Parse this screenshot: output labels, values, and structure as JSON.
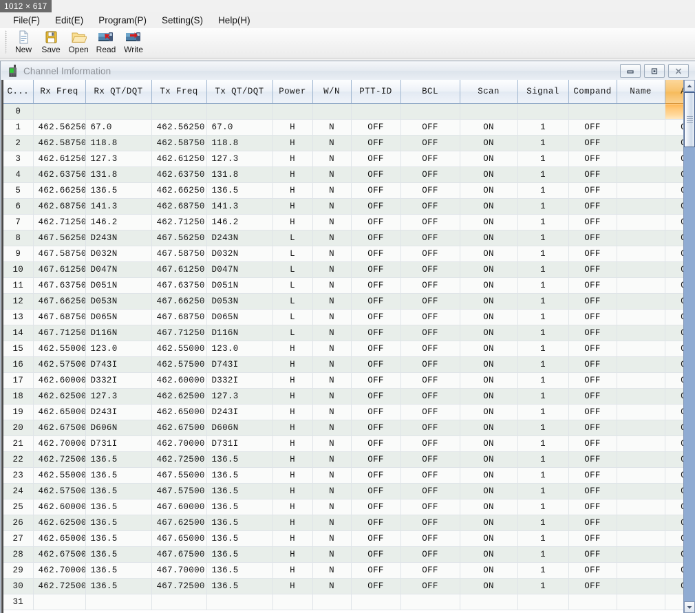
{
  "overlay": {
    "dimensions": "1012 × 617"
  },
  "menubar": {
    "items": [
      {
        "label": "File(F)",
        "name": "menu-file"
      },
      {
        "label": "Edit(E)",
        "name": "menu-edit"
      },
      {
        "label": "Program(P)",
        "name": "menu-program"
      },
      {
        "label": "Setting(S)",
        "name": "menu-setting"
      },
      {
        "label": "Help(H)",
        "name": "menu-help"
      }
    ]
  },
  "toolbar": {
    "buttons": [
      {
        "label": "New",
        "icon": "new-document-icon"
      },
      {
        "label": "Save",
        "icon": "floppy-disk-icon"
      },
      {
        "label": "Open",
        "icon": "folder-open-icon"
      },
      {
        "label": "Read",
        "icon": "read-from-radio-icon"
      },
      {
        "label": "Write",
        "icon": "write-to-radio-icon"
      }
    ]
  },
  "window": {
    "title": "Channel Imformation",
    "icon": "handheld-radio-icon",
    "minimize_label": "Minimize",
    "restore_label": "Restore",
    "close_label": "Close"
  },
  "grid": {
    "selected_column": "ANI",
    "columns": [
      "C...",
      "Rx Freq",
      "Rx QT/DQT",
      "Tx Freq",
      "Tx QT/DQT",
      "Power",
      "W/N",
      "PTT-ID",
      "BCL",
      "Scan",
      "Signal",
      "Compand",
      "Name",
      "ANI"
    ],
    "rows": [
      [
        "0",
        "",
        "",
        "",
        "",
        "",
        "",
        "",
        "",
        "",
        "",
        "",
        "",
        ""
      ],
      [
        "1",
        "462.56250",
        "67.0",
        "462.56250",
        "67.0",
        "H",
        "N",
        "OFF",
        "OFF",
        "ON",
        "1",
        "OFF",
        "",
        "OFF"
      ],
      [
        "2",
        "462.58750",
        "118.8",
        "462.58750",
        "118.8",
        "H",
        "N",
        "OFF",
        "OFF",
        "ON",
        "1",
        "OFF",
        "",
        "OFF"
      ],
      [
        "3",
        "462.61250",
        "127.3",
        "462.61250",
        "127.3",
        "H",
        "N",
        "OFF",
        "OFF",
        "ON",
        "1",
        "OFF",
        "",
        "OFF"
      ],
      [
        "4",
        "462.63750",
        "131.8",
        "462.63750",
        "131.8",
        "H",
        "N",
        "OFF",
        "OFF",
        "ON",
        "1",
        "OFF",
        "",
        "OFF"
      ],
      [
        "5",
        "462.66250",
        "136.5",
        "462.66250",
        "136.5",
        "H",
        "N",
        "OFF",
        "OFF",
        "ON",
        "1",
        "OFF",
        "",
        "OFF"
      ],
      [
        "6",
        "462.68750",
        "141.3",
        "462.68750",
        "141.3",
        "H",
        "N",
        "OFF",
        "OFF",
        "ON",
        "1",
        "OFF",
        "",
        "OFF"
      ],
      [
        "7",
        "462.71250",
        "146.2",
        "462.71250",
        "146.2",
        "H",
        "N",
        "OFF",
        "OFF",
        "ON",
        "1",
        "OFF",
        "",
        "OFF"
      ],
      [
        "8",
        "467.56250",
        "D243N",
        "467.56250",
        "D243N",
        "L",
        "N",
        "OFF",
        "OFF",
        "ON",
        "1",
        "OFF",
        "",
        "OFF"
      ],
      [
        "9",
        "467.58750",
        "D032N",
        "467.58750",
        "D032N",
        "L",
        "N",
        "OFF",
        "OFF",
        "ON",
        "1",
        "OFF",
        "",
        "OFF"
      ],
      [
        "10",
        "467.61250",
        "D047N",
        "467.61250",
        "D047N",
        "L",
        "N",
        "OFF",
        "OFF",
        "ON",
        "1",
        "OFF",
        "",
        "OFF"
      ],
      [
        "11",
        "467.63750",
        "D051N",
        "467.63750",
        "D051N",
        "L",
        "N",
        "OFF",
        "OFF",
        "ON",
        "1",
        "OFF",
        "",
        "OFF"
      ],
      [
        "12",
        "467.66250",
        "D053N",
        "467.66250",
        "D053N",
        "L",
        "N",
        "OFF",
        "OFF",
        "ON",
        "1",
        "OFF",
        "",
        "OFF"
      ],
      [
        "13",
        "467.68750",
        "D065N",
        "467.68750",
        "D065N",
        "L",
        "N",
        "OFF",
        "OFF",
        "ON",
        "1",
        "OFF",
        "",
        "OFF"
      ],
      [
        "14",
        "467.71250",
        "D116N",
        "467.71250",
        "D116N",
        "L",
        "N",
        "OFF",
        "OFF",
        "ON",
        "1",
        "OFF",
        "",
        "OFF"
      ],
      [
        "15",
        "462.55000",
        "123.0",
        "462.55000",
        "123.0",
        "H",
        "N",
        "OFF",
        "OFF",
        "ON",
        "1",
        "OFF",
        "",
        "OFF"
      ],
      [
        "16",
        "462.57500",
        "D743I",
        "462.57500",
        "D743I",
        "H",
        "N",
        "OFF",
        "OFF",
        "ON",
        "1",
        "OFF",
        "",
        "OFF"
      ],
      [
        "17",
        "462.60000",
        "D332I",
        "462.60000",
        "D332I",
        "H",
        "N",
        "OFF",
        "OFF",
        "ON",
        "1",
        "OFF",
        "",
        "OFF"
      ],
      [
        "18",
        "462.62500",
        "127.3",
        "462.62500",
        "127.3",
        "H",
        "N",
        "OFF",
        "OFF",
        "ON",
        "1",
        "OFF",
        "",
        "OFF"
      ],
      [
        "19",
        "462.65000",
        "D243I",
        "462.65000",
        "D243I",
        "H",
        "N",
        "OFF",
        "OFF",
        "ON",
        "1",
        "OFF",
        "",
        "OFF"
      ],
      [
        "20",
        "462.67500",
        "D606N",
        "462.67500",
        "D606N",
        "H",
        "N",
        "OFF",
        "OFF",
        "ON",
        "1",
        "OFF",
        "",
        "OFF"
      ],
      [
        "21",
        "462.70000",
        "D731I",
        "462.70000",
        "D731I",
        "H",
        "N",
        "OFF",
        "OFF",
        "ON",
        "1",
        "OFF",
        "",
        "OFF"
      ],
      [
        "22",
        "462.72500",
        "136.5",
        "462.72500",
        "136.5",
        "H",
        "N",
        "OFF",
        "OFF",
        "ON",
        "1",
        "OFF",
        "",
        "OFF"
      ],
      [
        "23",
        "462.55000",
        "136.5",
        "467.55000",
        "136.5",
        "H",
        "N",
        "OFF",
        "OFF",
        "ON",
        "1",
        "OFF",
        "",
        "OFF"
      ],
      [
        "24",
        "462.57500",
        "136.5",
        "467.57500",
        "136.5",
        "H",
        "N",
        "OFF",
        "OFF",
        "ON",
        "1",
        "OFF",
        "",
        "OFF"
      ],
      [
        "25",
        "462.60000",
        "136.5",
        "467.60000",
        "136.5",
        "H",
        "N",
        "OFF",
        "OFF",
        "ON",
        "1",
        "OFF",
        "",
        "OFF"
      ],
      [
        "26",
        "462.62500",
        "136.5",
        "467.62500",
        "136.5",
        "H",
        "N",
        "OFF",
        "OFF",
        "ON",
        "1",
        "OFF",
        "",
        "OFF"
      ],
      [
        "27",
        "462.65000",
        "136.5",
        "467.65000",
        "136.5",
        "H",
        "N",
        "OFF",
        "OFF",
        "ON",
        "1",
        "OFF",
        "",
        "OFF"
      ],
      [
        "28",
        "462.67500",
        "136.5",
        "467.67500",
        "136.5",
        "H",
        "N",
        "OFF",
        "OFF",
        "ON",
        "1",
        "OFF",
        "",
        "OFF"
      ],
      [
        "29",
        "462.70000",
        "136.5",
        "467.70000",
        "136.5",
        "H",
        "N",
        "OFF",
        "OFF",
        "ON",
        "1",
        "OFF",
        "",
        "OFF"
      ],
      [
        "30",
        "462.72500",
        "136.5",
        "467.72500",
        "136.5",
        "H",
        "N",
        "OFF",
        "OFF",
        "ON",
        "1",
        "OFF",
        "",
        "OFF"
      ],
      [
        "31",
        "",
        "",
        "",
        "",
        "",
        "",
        "",
        "",
        "",
        "",
        "",
        "",
        ""
      ]
    ]
  },
  "scrollbar": {
    "up_icon": "triangle-up-icon",
    "down_icon": "triangle-down-icon",
    "thumb_name": "vertical-scroll-thumb"
  },
  "colors": {
    "selected_header": "#f6bb5d",
    "selected_cell": "#ffc878",
    "row_even": "#e8eeea",
    "row_odd": "#fafbfa",
    "scroll_track": "#8fabd2"
  }
}
